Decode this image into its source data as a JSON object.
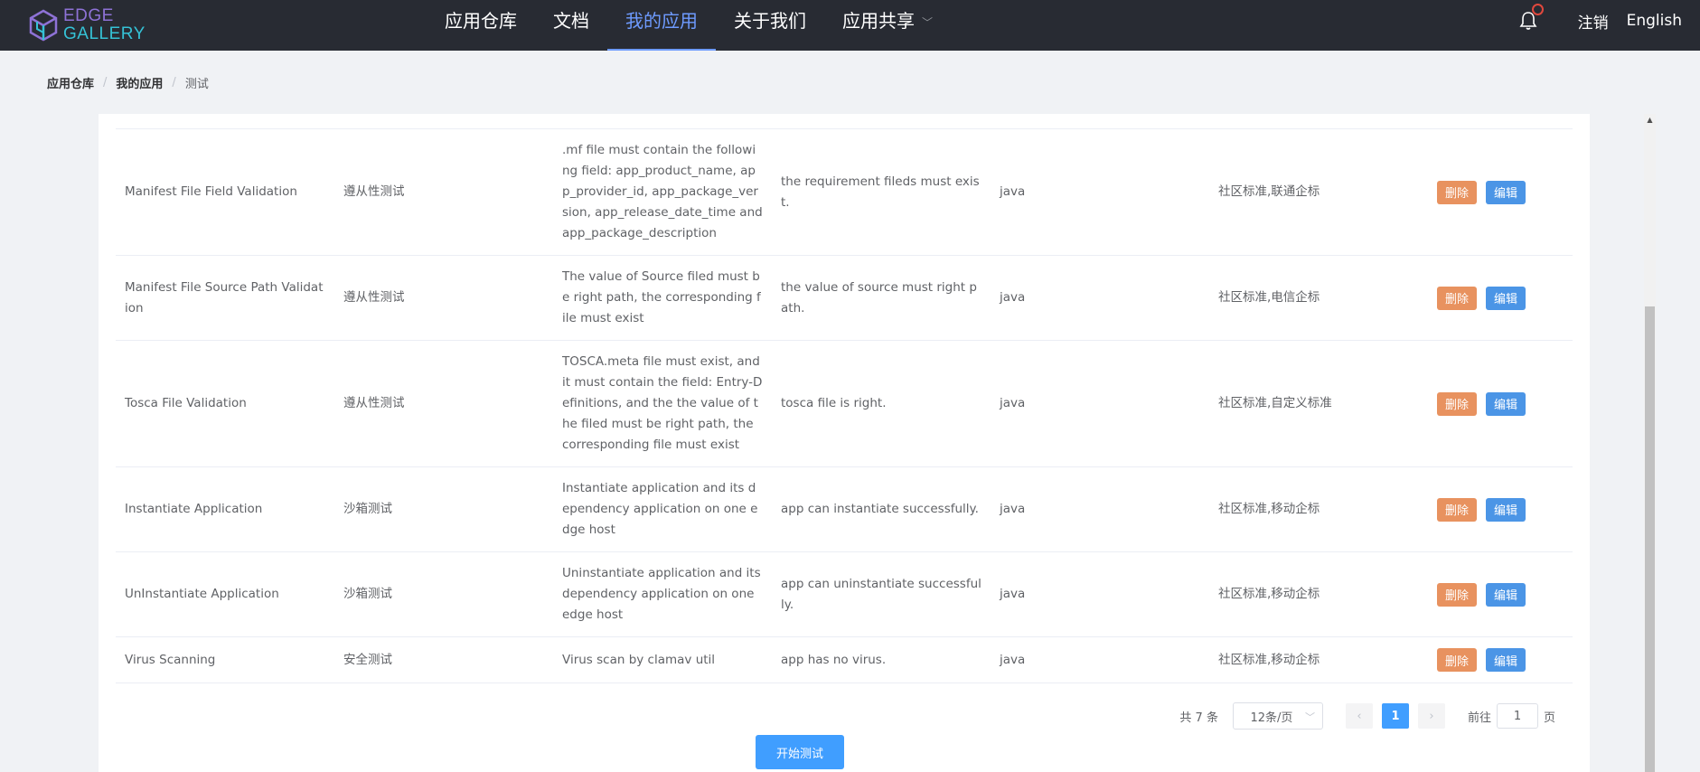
{
  "header": {
    "logo_line1": "EDGE",
    "logo_line2": "GALLERY",
    "menu": [
      {
        "label": "应用仓库"
      },
      {
        "label": "文档"
      },
      {
        "label": "我的应用"
      },
      {
        "label": "关于我们"
      },
      {
        "label": "应用共享"
      }
    ],
    "active_menu_index": 2,
    "logout": "注销",
    "language": "English",
    "accent_color": "#6e9bff"
  },
  "breadcrumb": [
    "应用仓库",
    "我的应用",
    "测试"
  ],
  "table": {
    "rows": [
      {
        "name": "Manifest File Field Validation",
        "type": "遵从性测试",
        "description": ".mf file must contain the following field: app_product_name, app_provider_id, app_package_version, app_release_date_time and app_package_description",
        "expected": "the requirement fileds must exist.",
        "language": "java",
        "standard": "社区标准,联通企标"
      },
      {
        "name": "Manifest File Source Path Validation",
        "type": "遵从性测试",
        "description": "The value of Source filed must be right path, the corresponding file must exist",
        "expected": "the value of source must right path.",
        "language": "java",
        "standard": "社区标准,电信企标"
      },
      {
        "name": "Tosca File Validation",
        "type": "遵从性测试",
        "description": "TOSCA.meta file must exist, and it must contain the field: Entry-Definitions, and the the value of the filed must be right path, the corresponding file must exist",
        "expected": "tosca file is right.",
        "language": "java",
        "standard": "社区标准,自定义标准"
      },
      {
        "name": "Instantiate Application",
        "type": "沙箱测试",
        "description": "Instantiate application and its dependency application on one edge host",
        "expected": "app can instantiate successfully.",
        "language": "java",
        "standard": "社区标准,移动企标"
      },
      {
        "name": "UnInstantiate Application",
        "type": "沙箱测试",
        "description": "Uninstantiate application and its dependency application on one edge host",
        "expected": "app can uninstantiate successfully.",
        "language": "java",
        "standard": "社区标准,移动企标"
      },
      {
        "name": "Virus Scanning",
        "type": "安全测试",
        "description": "Virus scan by clamav util",
        "expected": "app has no virus.",
        "language": "java",
        "standard": "社区标准,移动企标"
      }
    ],
    "delete_label": "删除",
    "edit_label": "编辑"
  },
  "pagination": {
    "total_text": "共 7 条",
    "page_size": "12条/页",
    "current_page": "1",
    "goto_label": "前往",
    "goto_value": "1",
    "page_suffix": "页"
  },
  "start_test_label": "开始测试",
  "colors": {
    "nav_bg": "#282b33",
    "primary": "#409eff",
    "delete_btn": "#e8925f",
    "edit_btn": "#4b95e6"
  }
}
